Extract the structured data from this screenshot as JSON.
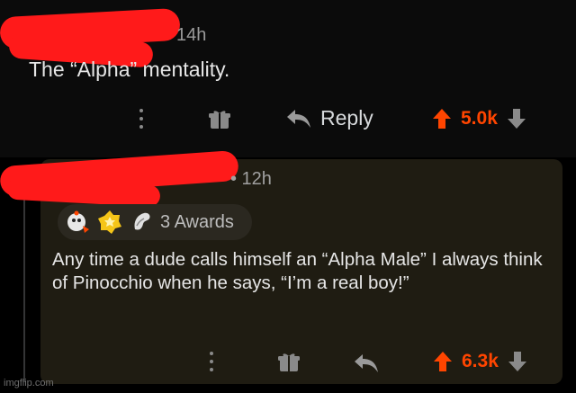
{
  "comments": [
    {
      "age": "14h",
      "text": "The “Alpha” mentality.",
      "reply_label": "Reply",
      "score": "5.0k",
      "score_color": "#ff4500"
    },
    {
      "age": "• 12h",
      "awards_label": "3 Awards",
      "awards": [
        "rocket-like-icon",
        "gold-star-icon",
        "wholesome-hand-icon"
      ],
      "text": "Any time a dude calls himself an “Alpha Male” I always think of Pinocchio when he says, “I’m a real boy!”",
      "score": "6.3k",
      "score_color": "#ff4500"
    }
  ],
  "redaction_color": "#ff1a1a",
  "watermark": "imgflip.com"
}
